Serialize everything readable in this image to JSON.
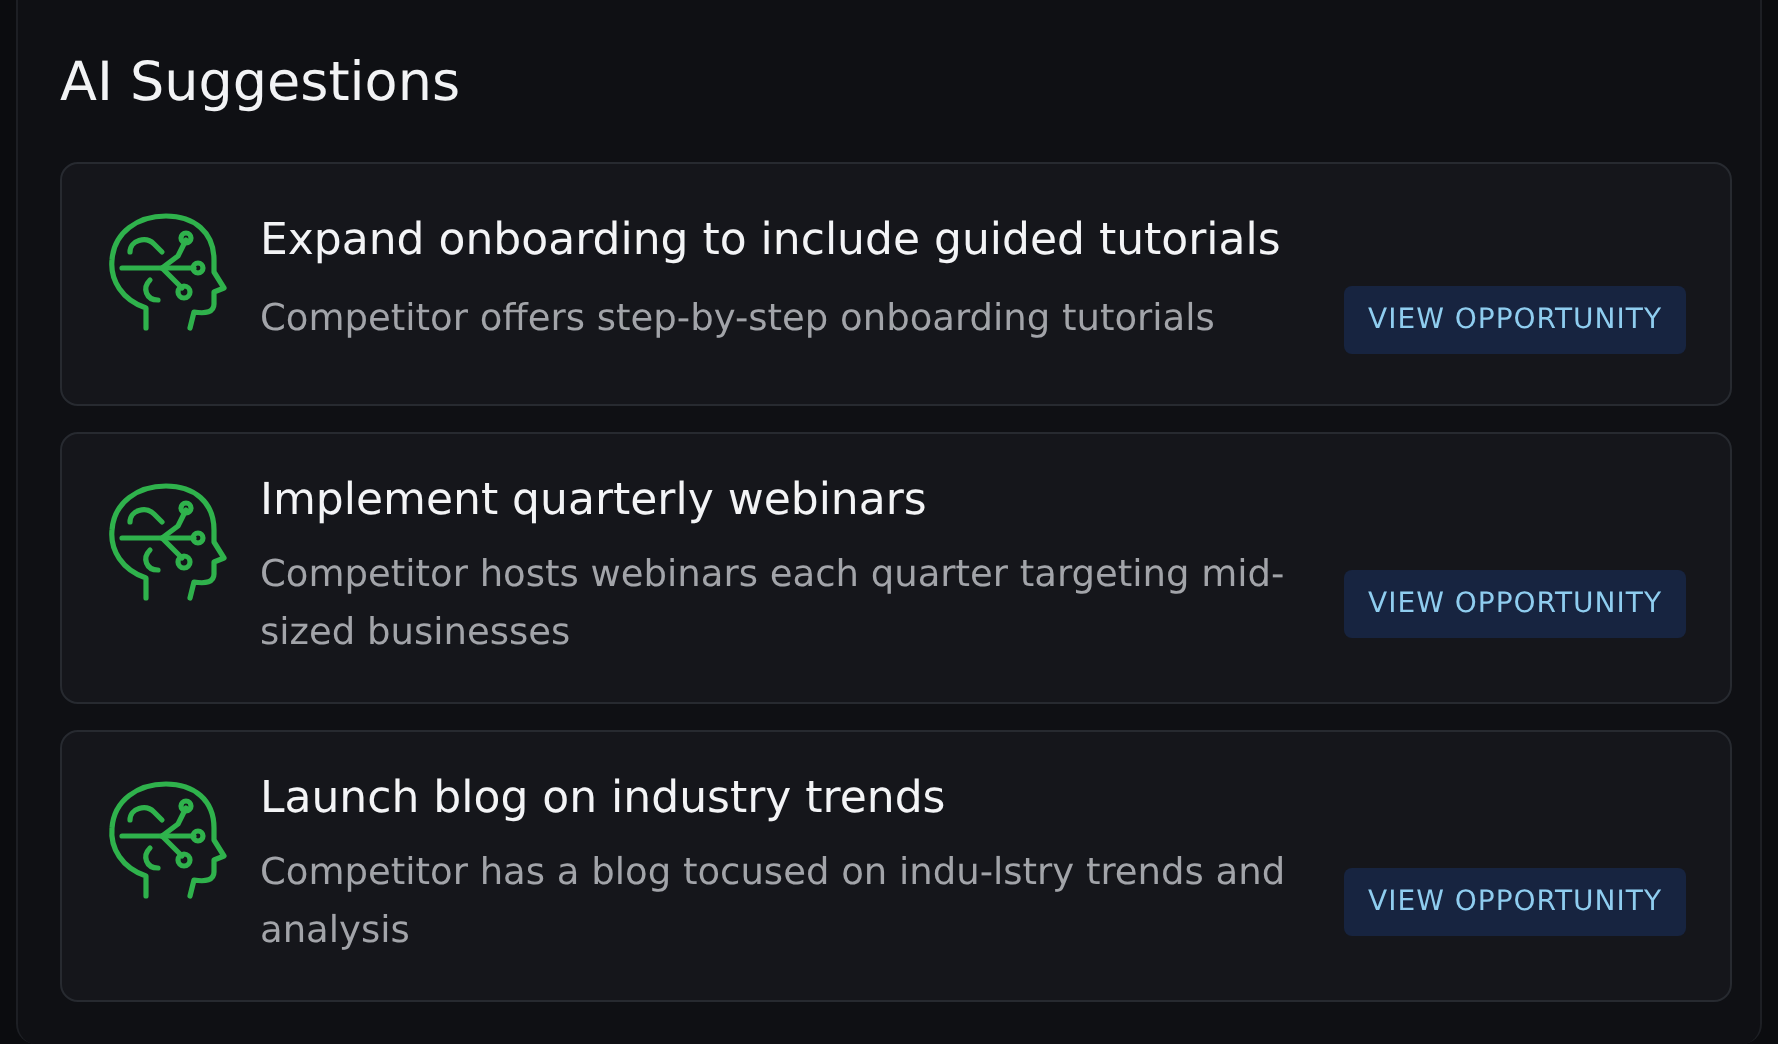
{
  "title": "AI Suggestions",
  "suggestions": [
    {
      "title": "Expand onboarding to include guided tutorials",
      "description": "Competitor offers step-by-step onboarding tutorials",
      "action": "VIEW OPPORTUNITY"
    },
    {
      "title": "Implement quarterly webinars",
      "description": "Competitor hosts webinars each quarter targeting mid-sized businesses",
      "action": "VIEW OPPORTUNITY"
    },
    {
      "title": "Launch blog on industry trends",
      "description": "Competitor has a blog tocused on indu-lstry trends and analysis",
      "action": "VIEW OPPORTUNITY"
    }
  ]
}
